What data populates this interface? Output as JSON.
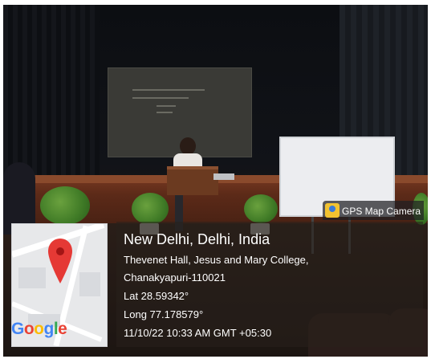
{
  "stamp": {
    "location_title": "New Delhi, Delhi, India",
    "address_line_1": "Thevenet Hall, Jesus and Mary College,",
    "address_line_2": "Chanakyapuri-110021",
    "latitude": "Lat 28.59342°",
    "longitude": "Long 77.178579°",
    "datetime": "11/10/22 10:33 AM GMT +05:30"
  },
  "app_badge": {
    "label": "GPS Map Camera",
    "icon": "gps-map-camera-icon"
  },
  "map": {
    "logo_letters": [
      "G",
      "o",
      "o",
      "g",
      "l",
      "e"
    ],
    "logo_colors": [
      "#4285F4",
      "#EA4335",
      "#FBBC05",
      "#4285F4",
      "#34A853",
      "#EA4335"
    ],
    "pin_color": "#E53935",
    "pin_icon": "map-pin-icon"
  }
}
